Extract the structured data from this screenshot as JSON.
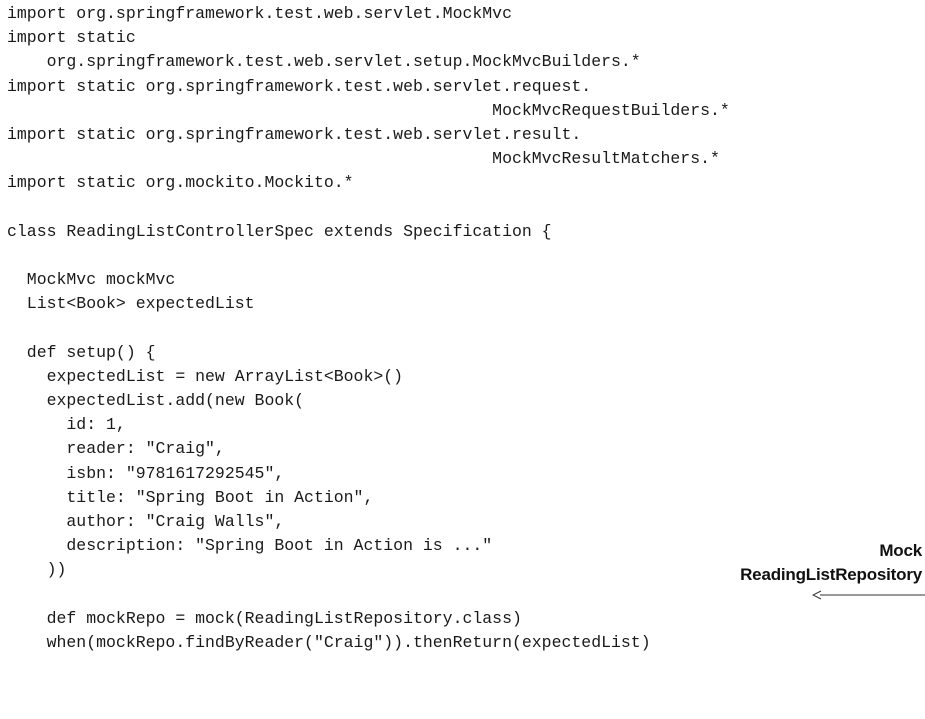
{
  "code_lines": [
    "import org.springframework.test.web.servlet.MockMvc",
    "import static",
    "    org.springframework.test.web.servlet.setup.MockMvcBuilders.*",
    "import static org.springframework.test.web.servlet.request.",
    "                                                 MockMvcRequestBuilders.*",
    "import static org.springframework.test.web.servlet.result.",
    "                                                 MockMvcResultMatchers.*",
    "import static org.mockito.Mockito.*",
    "",
    "class ReadingListControllerSpec extends Specification {",
    "",
    "  MockMvc mockMvc",
    "  List<Book> expectedList",
    "",
    "  def setup() {",
    "    expectedList = new ArrayList<Book>()",
    "    expectedList.add(new Book(",
    "      id: 1,",
    "      reader: \"Craig\",",
    "      isbn: \"9781617292545\",",
    "      title: \"Spring Boot in Action\",",
    "      author: \"Craig Walls\",",
    "      description: \"Spring Boot in Action is ...\"",
    "    ))",
    "",
    "    def mockRepo = mock(ReadingListRepository.class)",
    "    when(mockRepo.findByReader(\"Craig\")).thenReturn(expectedList)"
  ],
  "annotation": {
    "line1": "Mock",
    "line2": "ReadingListRepository"
  },
  "colors": {
    "text": "#1a1a1a",
    "arrow": "#333333",
    "background": "#ffffff"
  }
}
